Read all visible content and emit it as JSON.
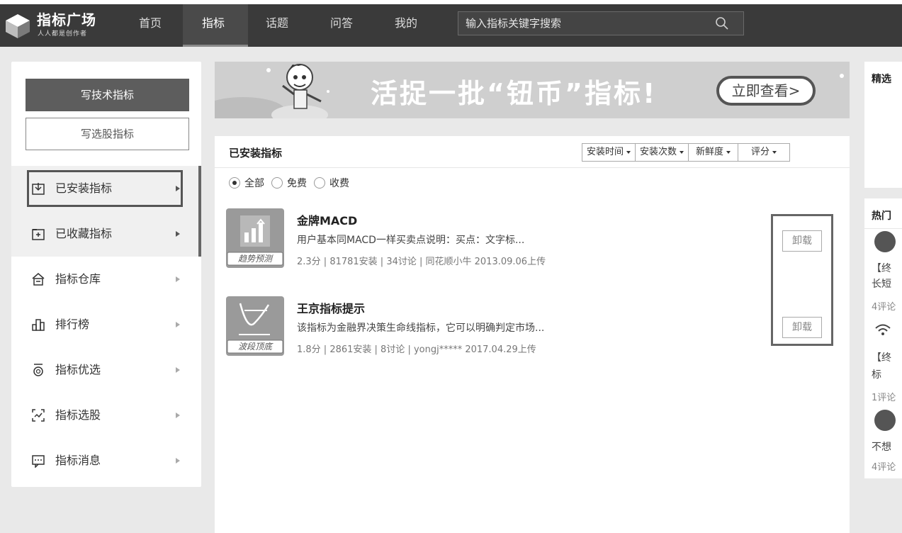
{
  "header": {
    "logo_title": "指标广场",
    "logo_subtitle": "人人都是创作者",
    "nav": [
      "首页",
      "指标",
      "话题",
      "问答",
      "我的"
    ],
    "active_nav": "指标",
    "search_placeholder": "输入指标关键字搜索"
  },
  "sidebar": {
    "write_tech_button": "写技术指标",
    "write_select_button": "写选股指标",
    "items": [
      {
        "label": "已安装指标",
        "icon": "download-tray-icon"
      },
      {
        "label": "已收藏指标",
        "icon": "favorite-folder-icon"
      },
      {
        "label": "指标仓库",
        "icon": "warehouse-icon"
      },
      {
        "label": "排行榜",
        "icon": "ranking-icon"
      },
      {
        "label": "指标优选",
        "icon": "medal-icon"
      },
      {
        "label": "指标选股",
        "icon": "stock-select-icon"
      },
      {
        "label": "指标消息",
        "icon": "message-icon"
      }
    ]
  },
  "banner": {
    "text": "活捉一批“钮币”指标!",
    "button": "立即查看>"
  },
  "main": {
    "title": "已安装指标",
    "sort": [
      "安装时间",
      "安装次数",
      "新鲜度",
      "评分"
    ],
    "filters": [
      "全部",
      "免费",
      "收费"
    ],
    "selected_filter": "全部",
    "items": [
      {
        "name": "金牌MACD",
        "desc": "用户基本同MACD一样买卖点说明：买点：文字标...",
        "meta": "2.3分 | 81781安装 | 34讨论 | 同花顺小牛 2013.09.06上传",
        "tag": "趋势预测",
        "action": "卸载"
      },
      {
        "name": "王京指标提示",
        "desc": "该指标为金融界决策生命线指标，它可以明确判定市场...",
        "meta": "1.8分 | 2861安装 | 8讨论 | yongj***** 2017.04.29上传",
        "tag": "波段顶底",
        "action": "卸载"
      }
    ]
  },
  "right": {
    "featured_title": "精选",
    "hot_title": "热门",
    "hot_items": [
      {
        "line1": "【终",
        "line2": "长短",
        "comments": "4评论"
      },
      {
        "line1": "【终",
        "line2": "标",
        "comments": "1评论"
      },
      {
        "line1": "不想",
        "line2": "",
        "comments": "4评论"
      }
    ]
  },
  "colors": {
    "topbar": "#3a3a3a",
    "primary_button": "#5d5d5d",
    "page_bg": "#e9e9e9"
  }
}
